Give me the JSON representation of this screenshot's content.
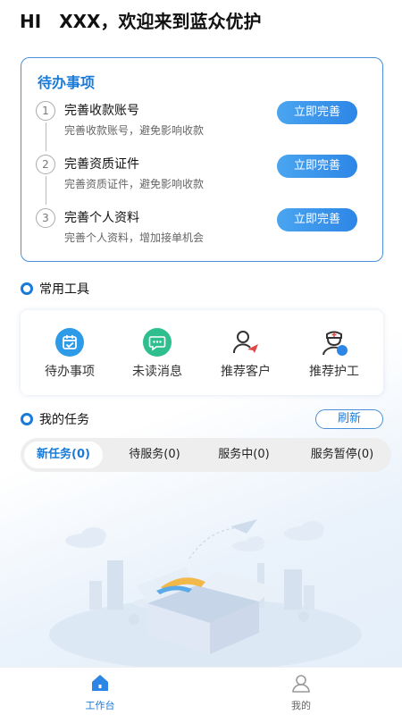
{
  "greeting": {
    "hi": "HI",
    "name": "XXX",
    "welcome": "，欢迎来到蓝众优护"
  },
  "todo": {
    "title": "待办事项",
    "items": [
      {
        "num": "1",
        "name": "完善收款账号",
        "desc": "完善收款账号，避免影响收款",
        "button": "立即完善"
      },
      {
        "num": "2",
        "name": "完善资质证件",
        "desc": "完善资质证件，避免影响收款",
        "button": "立即完善"
      },
      {
        "num": "3",
        "name": "完善个人资料",
        "desc": "完善个人资料，增加接单机会",
        "button": "立即完善"
      }
    ]
  },
  "tools": {
    "title": "常用工具",
    "items": [
      {
        "label": "待办事项",
        "icon": "calendar-icon"
      },
      {
        "label": "未读消息",
        "icon": "message-icon"
      },
      {
        "label": "推荐客户",
        "icon": "recommend-customer-icon"
      },
      {
        "label": "推荐护工",
        "icon": "nurse-icon"
      }
    ]
  },
  "tasks": {
    "title": "我的任务",
    "refresh": "刷新",
    "tabs": [
      "新任务(0)",
      "待服务(0)",
      "服务中(0)",
      "服务暂停(0)"
    ]
  },
  "nav": {
    "items": [
      {
        "label": "工作台",
        "icon": "home-icon"
      },
      {
        "label": "我的",
        "icon": "user-icon"
      }
    ]
  },
  "colors": {
    "accent": "#1a7ad8",
    "button": "#2d86e6",
    "inactive": "#666666"
  }
}
